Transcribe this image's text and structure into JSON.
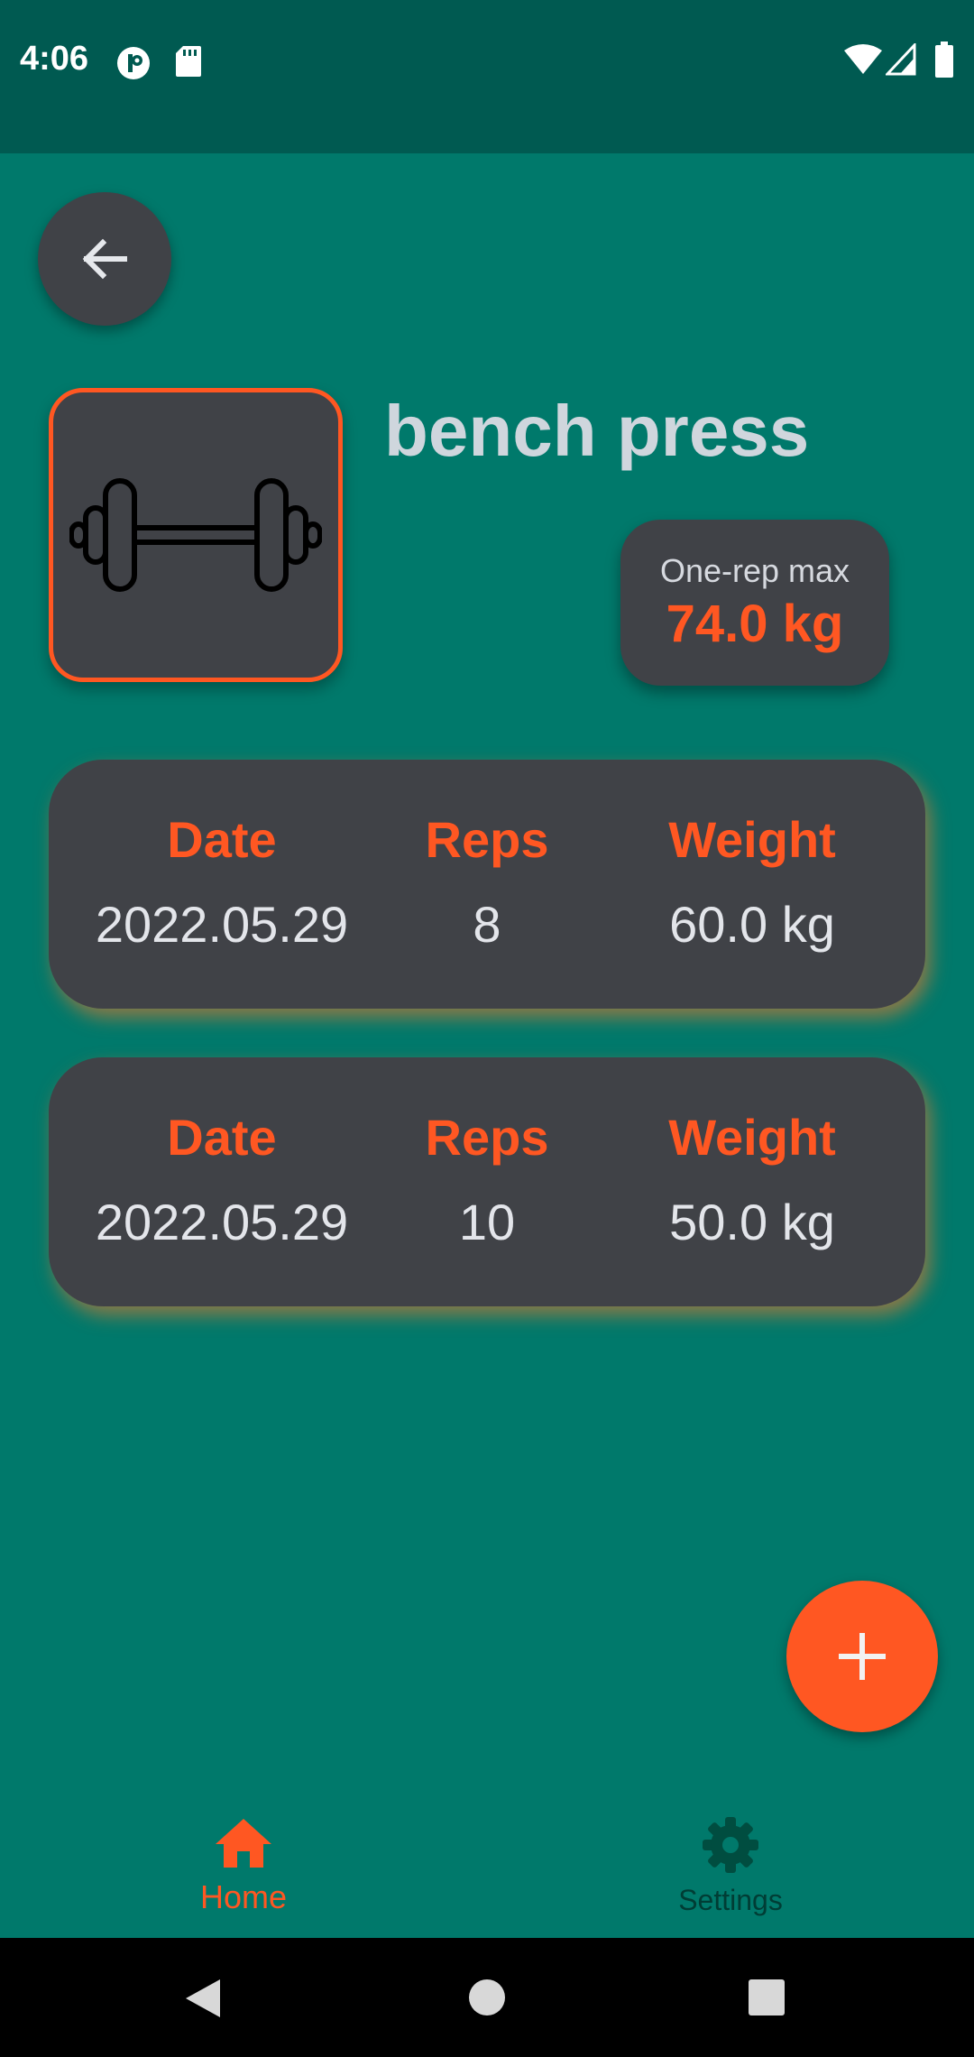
{
  "status_bar": {
    "time": "4:06"
  },
  "exercise": {
    "name": "bench press",
    "image_icon": "dumbbell-icon"
  },
  "one_rep_max": {
    "label": "One-rep max",
    "value": "74.0 kg"
  },
  "sets": [
    {
      "date_header": "Date",
      "reps_header": "Reps",
      "weight_header": "Weight",
      "date": "2022.05.29",
      "reps": "8",
      "weight": "60.0 kg"
    },
    {
      "date_header": "Date",
      "reps_header": "Reps",
      "weight_header": "Weight",
      "date": "2022.05.29",
      "reps": "10",
      "weight": "50.0 kg"
    }
  ],
  "bottom_nav": {
    "items": [
      {
        "label": "Home",
        "icon": "home-icon",
        "active": true
      },
      {
        "label": "Settings",
        "icon": "gear-icon",
        "active": false
      }
    ]
  },
  "colors": {
    "accent": "#ff5722",
    "background": "#00796b",
    "status_bar": "#005a51",
    "card": "#404247",
    "text_light": "#cfd6dd"
  }
}
